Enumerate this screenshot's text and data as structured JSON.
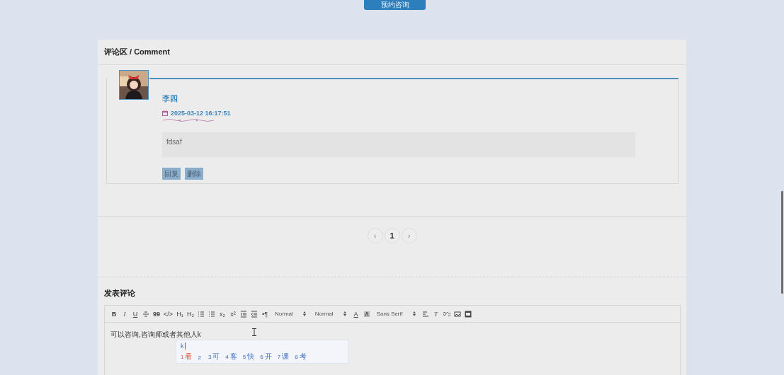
{
  "top_button": "预约咨询",
  "comment_section": {
    "title": "评论区 / Comment",
    "comments": [
      {
        "author": "李四",
        "date": "2025-03-12 16:17:51",
        "content": "fdsaf",
        "actions": [
          "回复",
          "删除"
        ]
      }
    ]
  },
  "pagination": {
    "prev": "‹",
    "next": "›",
    "pages": [
      {
        "label": "1",
        "selected": true
      }
    ]
  },
  "compose": {
    "title": "发表评论",
    "toolbar": [
      {
        "kind": "glyph",
        "label": "B"
      },
      {
        "kind": "glyph",
        "label": "I"
      },
      {
        "kind": "glyph",
        "label": "U"
      },
      {
        "kind": "icon"
      },
      {
        "kind": "glyph",
        "label": "99"
      },
      {
        "kind": "glyph",
        "label": "</>"
      },
      {
        "kind": "glyph",
        "label": "H₁"
      },
      {
        "kind": "glyph",
        "label": "H₂"
      },
      {
        "kind": "icon"
      },
      {
        "kind": "icon"
      },
      {
        "kind": "glyph",
        "label": "x₂"
      },
      {
        "kind": "glyph",
        "label": "x²"
      },
      {
        "kind": "icon"
      },
      {
        "kind": "icon"
      },
      {
        "kind": "glyph",
        "label": "•¶"
      },
      {
        "kind": "picker",
        "label": "Normal"
      },
      {
        "kind": "picker",
        "label": "Normal"
      },
      {
        "kind": "glyph",
        "label": "A"
      },
      {
        "kind": "icon"
      },
      {
        "kind": "picker",
        "label": "Sans Serif"
      },
      {
        "kind": "icon"
      },
      {
        "kind": "glyph",
        "label": "T"
      },
      {
        "kind": "icon"
      },
      {
        "kind": "icon"
      },
      {
        "kind": "icon"
      }
    ],
    "text": "可以咨询,咨询师或者其他人k",
    "ime": {
      "input": "k",
      "candidates": [
        {
          "num": "1",
          "text": "看",
          "selected": true
        },
        {
          "num": "2",
          "selected": false
        },
        {
          "num": "3",
          "text": "可",
          "selected": false
        },
        {
          "num": "4",
          "text": "客",
          "selected": false
        },
        {
          "num": "5",
          "text": "快",
          "selected": false
        },
        {
          "num": "6",
          "text": "开",
          "selected": false
        },
        {
          "num": "7",
          "text": "课",
          "selected": false
        },
        {
          "num": "8",
          "text": "考",
          "selected": false
        }
      ]
    }
  }
}
